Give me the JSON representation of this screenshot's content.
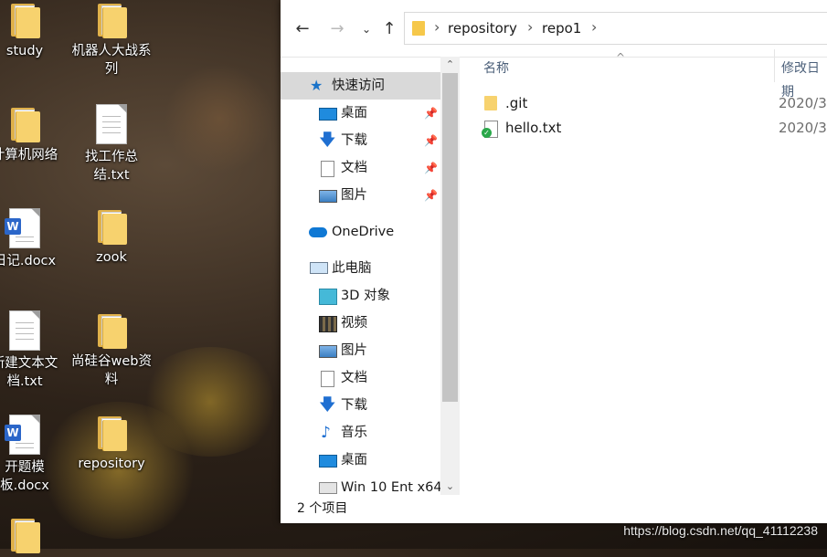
{
  "desktop": {
    "icons": [
      {
        "label": "study",
        "type": "folder"
      },
      {
        "label": "机器人大战系列",
        "type": "folder"
      },
      {
        "label": "计算机网络",
        "type": "folder"
      },
      {
        "label": "找工作总结.txt",
        "type": "text-file"
      },
      {
        "label": "日记.docx",
        "type": "word-doc"
      },
      {
        "label": "zook",
        "type": "folder"
      },
      {
        "label": "新建文本文档.txt",
        "type": "text-file"
      },
      {
        "label": "尚硅谷web资料",
        "type": "folder"
      },
      {
        "label": "开题模板.docx",
        "type": "word-doc"
      },
      {
        "label": "repository",
        "type": "folder"
      }
    ]
  },
  "explorer": {
    "nav_buttons": {
      "back": "back-arrow",
      "forward": "forward-arrow",
      "recent": "chevron-down",
      "up": "up-arrow"
    },
    "breadcrumb": [
      "repository",
      "repo1"
    ],
    "nav_pane": {
      "quick_access": "快速访问",
      "quick_items": [
        "桌面",
        "下载",
        "文档",
        "图片"
      ],
      "onedrive": "OneDrive",
      "this_pc": "此电脑",
      "pc_items": [
        "3D 对象",
        "视频",
        "图片",
        "文档",
        "下载",
        "音乐",
        "桌面",
        "Win 10 Ent x64"
      ]
    },
    "columns": {
      "name": "名称",
      "modified": "修改日期"
    },
    "files": [
      {
        "name": ".git",
        "date": "2020/3",
        "icon": "folder-icon"
      },
      {
        "name": "hello.txt",
        "date": "2020/3",
        "icon": "git-synced-text-file-icon"
      }
    ],
    "status": "2 个项目"
  },
  "watermark": "https://blog.csdn.net/qq_41112238",
  "colors": {
    "accent": "#0078d7",
    "folder": "#f7d26e",
    "selection": "#d9d9d9"
  }
}
